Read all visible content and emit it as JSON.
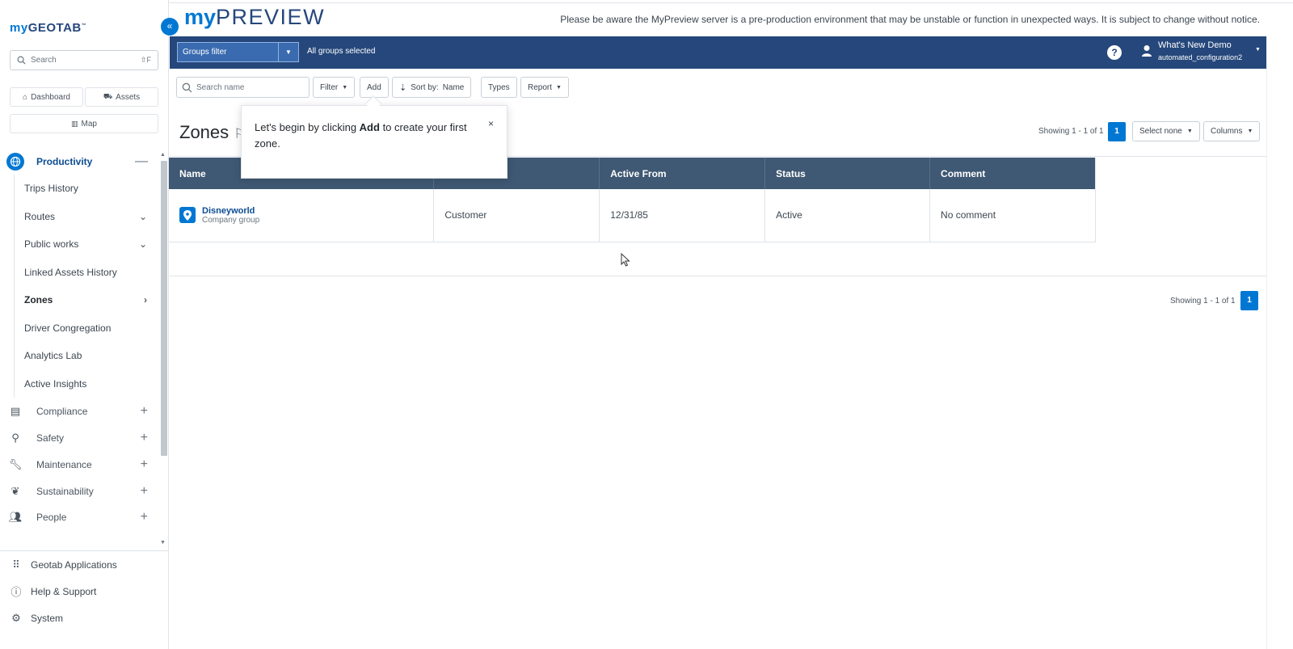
{
  "brand": {
    "my": "my",
    "rest": "GEOTAB",
    "tm": "™"
  },
  "sidebar": {
    "collapse_label": "«",
    "search_placeholder": "Search",
    "search_shortcut": "⇧F",
    "quick": {
      "dashboard": "Dashboard",
      "assets": "Assets",
      "map": "Map"
    },
    "productivity": {
      "label": "Productivity",
      "toggle": "—",
      "items": [
        {
          "label": "Trips History",
          "chevron": ""
        },
        {
          "label": "Routes",
          "chevron": "⌄"
        },
        {
          "label": "Public works",
          "chevron": "⌄"
        },
        {
          "label": "Linked Assets History",
          "chevron": ""
        },
        {
          "label": "Zones",
          "chevron": "›"
        },
        {
          "label": "Driver Congregation",
          "chevron": ""
        },
        {
          "label": "Analytics Lab",
          "chevron": ""
        },
        {
          "label": "Active Insights",
          "chevron": ""
        }
      ]
    },
    "sections": [
      {
        "label": "Compliance",
        "toggle": "+"
      },
      {
        "label": "Safety",
        "toggle": "+"
      },
      {
        "label": "Maintenance",
        "toggle": "+"
      },
      {
        "label": "Sustainability",
        "toggle": "+"
      },
      {
        "label": "People",
        "toggle": "+"
      }
    ],
    "footer": [
      {
        "label": "Geotab Applications"
      },
      {
        "label": "Help & Support"
      },
      {
        "label": "System"
      }
    ]
  },
  "banner": {
    "logo_my": "my",
    "logo_rest": "PREVIEW",
    "notice": "Please be aware the MyPreview server is a pre-production environment that may be unstable or function in unexpected ways. It is subject to change without notice."
  },
  "header": {
    "groups_filter": "Groups filter",
    "groups_selected": "All groups selected",
    "help": "?",
    "user_name": "What's New Demo",
    "user_db": "automated_configuration2"
  },
  "toolbar": {
    "search_placeholder": "Search name",
    "filter": "Filter",
    "add": "Add",
    "sort_label": "Sort by:",
    "sort_value": "Name",
    "types": "Types",
    "report": "Report"
  },
  "page": {
    "title": "Zones",
    "showing_top": "Showing 1 - 1 of 1",
    "page_num": "1",
    "select_none": "Select none",
    "columns": "Columns",
    "showing_bottom": "Showing 1 - 1 of 1"
  },
  "table": {
    "headers": [
      "Name",
      "",
      "Active From",
      "Status",
      "Comment"
    ],
    "rows": [
      {
        "name": "Disneyworld",
        "group": "Company group",
        "type": "Customer",
        "active_from": "12/31/85",
        "status": "Active",
        "comment": "No comment"
      }
    ]
  },
  "tooltip": {
    "pre": "Let's begin by clicking ",
    "bold": "Add",
    "post": " to create your first zone.",
    "close": "×"
  },
  "colors": {
    "primary": "#0078d3",
    "header": "#25477b",
    "table_header": "#3f5873"
  }
}
